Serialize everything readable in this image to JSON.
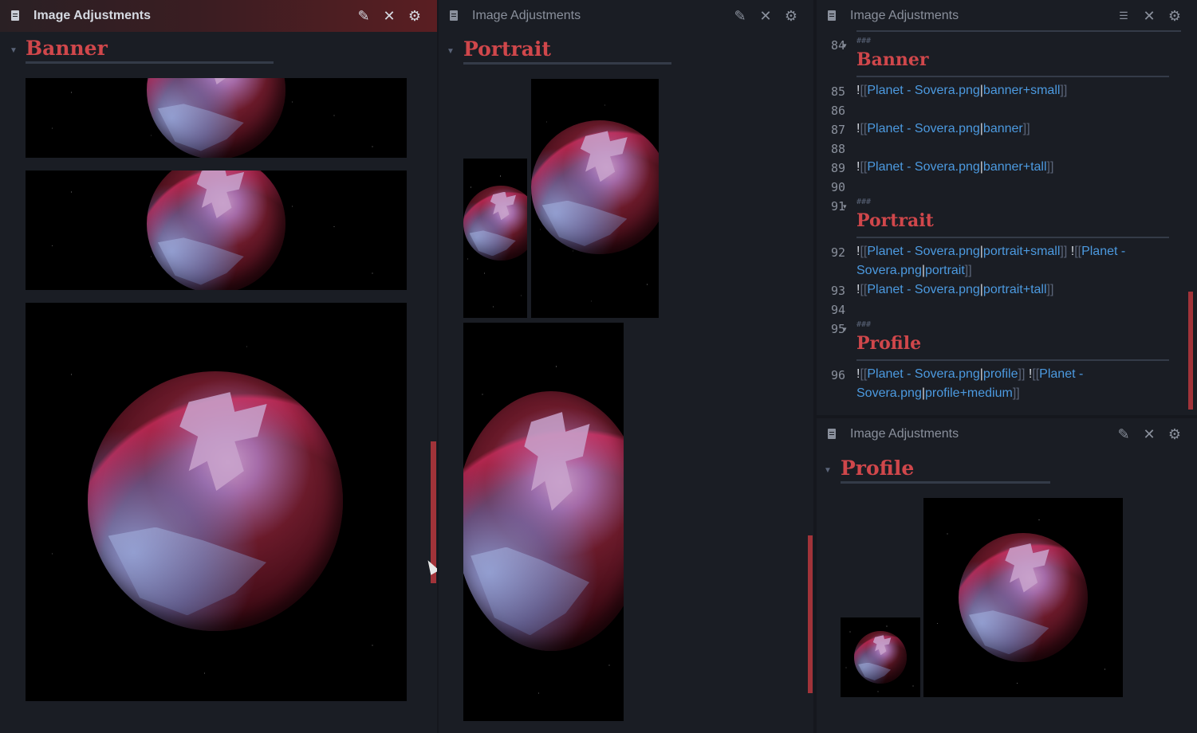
{
  "panes": [
    {
      "title": "Image Adjustments",
      "heading": "Banner"
    },
    {
      "title": "Image Adjustments",
      "heading": "Portrait"
    },
    {
      "title": "Image Adjustments"
    },
    {
      "title": "Image Adjustments",
      "heading": "Profile"
    }
  ],
  "icons": {
    "doc": "document-icon",
    "edit": "pencil-icon",
    "close": "close-icon",
    "settings": "gear-icon",
    "outline": "outline-icon"
  },
  "glyphs": {
    "edit": "✎",
    "close": "✕",
    "settings": "⚙",
    "outline": "☰",
    "collapse": "▼",
    "fold": "▾"
  },
  "editor": {
    "lines": [
      {
        "num": "84",
        "fold": true,
        "marker": "###",
        "heading": "Banner"
      },
      {
        "num": "85",
        "parts": [
          {
            "t": "!",
            "k": "plain"
          },
          {
            "t": "[[",
            "k": "br"
          },
          {
            "t": "Planet - Sovera.png",
            "k": "link"
          },
          {
            "t": "|",
            "k": "plain"
          },
          {
            "t": "banner+small",
            "k": "link"
          },
          {
            "t": "]]",
            "k": "br"
          }
        ]
      },
      {
        "num": "86"
      },
      {
        "num": "87",
        "parts": [
          {
            "t": "!",
            "k": "plain"
          },
          {
            "t": "[[",
            "k": "br"
          },
          {
            "t": "Planet - Sovera.png",
            "k": "link"
          },
          {
            "t": "|",
            "k": "plain"
          },
          {
            "t": "banner",
            "k": "link"
          },
          {
            "t": "]]",
            "k": "br"
          }
        ]
      },
      {
        "num": "88"
      },
      {
        "num": "89",
        "parts": [
          {
            "t": "!",
            "k": "plain"
          },
          {
            "t": "[[",
            "k": "br"
          },
          {
            "t": "Planet - Sovera.png",
            "k": "link"
          },
          {
            "t": "|",
            "k": "plain"
          },
          {
            "t": "banner+tall",
            "k": "link"
          },
          {
            "t": "]]",
            "k": "br"
          }
        ]
      },
      {
        "num": "90"
      },
      {
        "num": "91",
        "fold": true,
        "marker": "###",
        "heading": "Portrait"
      },
      {
        "num": "92",
        "parts": [
          {
            "t": "!",
            "k": "plain"
          },
          {
            "t": "[[",
            "k": "br"
          },
          {
            "t": "Planet - Sovera.png",
            "k": "link"
          },
          {
            "t": "|",
            "k": "plain"
          },
          {
            "t": "portrait+small",
            "k": "link"
          },
          {
            "t": "]]",
            "k": "br"
          },
          {
            "t": " !",
            "k": "plain"
          },
          {
            "t": "[[",
            "k": "br"
          },
          {
            "t": "Planet - Sovera.png",
            "k": "link"
          },
          {
            "t": "|",
            "k": "plain"
          },
          {
            "t": "portrait",
            "k": "link"
          },
          {
            "t": "]]",
            "k": "br"
          }
        ]
      },
      {
        "num": "93",
        "parts": [
          {
            "t": "!",
            "k": "plain"
          },
          {
            "t": "[[",
            "k": "br"
          },
          {
            "t": "Planet - Sovera.png",
            "k": "link"
          },
          {
            "t": "|",
            "k": "plain"
          },
          {
            "t": "portrait+tall",
            "k": "link"
          },
          {
            "t": "]]",
            "k": "br"
          }
        ]
      },
      {
        "num": "94"
      },
      {
        "num": "95",
        "fold": true,
        "marker": "###",
        "heading": "Profile"
      },
      {
        "num": "96",
        "parts": [
          {
            "t": "!",
            "k": "plain"
          },
          {
            "t": "[[",
            "k": "br"
          },
          {
            "t": "Planet - Sovera.png",
            "k": "link"
          },
          {
            "t": "|",
            "k": "plain"
          },
          {
            "t": "profile",
            "k": "link"
          },
          {
            "t": "]]",
            "k": "br"
          },
          {
            "t": " !",
            "k": "plain"
          },
          {
            "t": "[[",
            "k": "br"
          },
          {
            "t": "Planet - Sovera.png",
            "k": "link"
          },
          {
            "t": "|",
            "k": "plain"
          },
          {
            "t": "profile+medium",
            "k": "link"
          },
          {
            "t": "]]",
            "k": "br"
          }
        ]
      }
    ]
  },
  "colors": {
    "accent": "#d0474b",
    "link": "#4c9ae0",
    "scrollbar": "#a13339",
    "background": "#1a1d24"
  }
}
